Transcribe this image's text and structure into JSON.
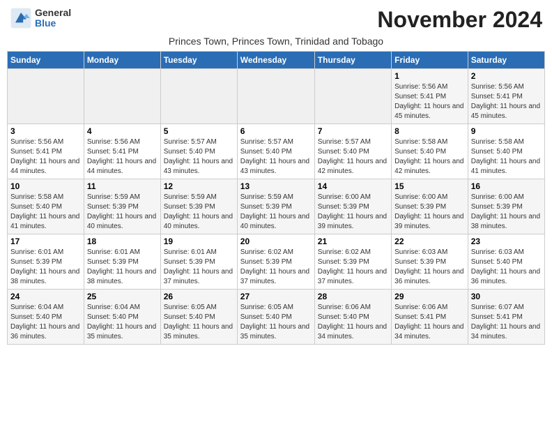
{
  "logo": {
    "general": "General",
    "blue": "Blue"
  },
  "title": "November 2024",
  "subtitle": "Princes Town, Princes Town, Trinidad and Tobago",
  "headers": [
    "Sunday",
    "Monday",
    "Tuesday",
    "Wednesday",
    "Thursday",
    "Friday",
    "Saturday"
  ],
  "rows": [
    [
      {
        "day": "",
        "info": ""
      },
      {
        "day": "",
        "info": ""
      },
      {
        "day": "",
        "info": ""
      },
      {
        "day": "",
        "info": ""
      },
      {
        "day": "",
        "info": ""
      },
      {
        "day": "1",
        "info": "Sunrise: 5:56 AM\nSunset: 5:41 PM\nDaylight: 11 hours and 45 minutes."
      },
      {
        "day": "2",
        "info": "Sunrise: 5:56 AM\nSunset: 5:41 PM\nDaylight: 11 hours and 45 minutes."
      }
    ],
    [
      {
        "day": "3",
        "info": "Sunrise: 5:56 AM\nSunset: 5:41 PM\nDaylight: 11 hours and 44 minutes."
      },
      {
        "day": "4",
        "info": "Sunrise: 5:56 AM\nSunset: 5:41 PM\nDaylight: 11 hours and 44 minutes."
      },
      {
        "day": "5",
        "info": "Sunrise: 5:57 AM\nSunset: 5:40 PM\nDaylight: 11 hours and 43 minutes."
      },
      {
        "day": "6",
        "info": "Sunrise: 5:57 AM\nSunset: 5:40 PM\nDaylight: 11 hours and 43 minutes."
      },
      {
        "day": "7",
        "info": "Sunrise: 5:57 AM\nSunset: 5:40 PM\nDaylight: 11 hours and 42 minutes."
      },
      {
        "day": "8",
        "info": "Sunrise: 5:58 AM\nSunset: 5:40 PM\nDaylight: 11 hours and 42 minutes."
      },
      {
        "day": "9",
        "info": "Sunrise: 5:58 AM\nSunset: 5:40 PM\nDaylight: 11 hours and 41 minutes."
      }
    ],
    [
      {
        "day": "10",
        "info": "Sunrise: 5:58 AM\nSunset: 5:40 PM\nDaylight: 11 hours and 41 minutes."
      },
      {
        "day": "11",
        "info": "Sunrise: 5:59 AM\nSunset: 5:39 PM\nDaylight: 11 hours and 40 minutes."
      },
      {
        "day": "12",
        "info": "Sunrise: 5:59 AM\nSunset: 5:39 PM\nDaylight: 11 hours and 40 minutes."
      },
      {
        "day": "13",
        "info": "Sunrise: 5:59 AM\nSunset: 5:39 PM\nDaylight: 11 hours and 40 minutes."
      },
      {
        "day": "14",
        "info": "Sunrise: 6:00 AM\nSunset: 5:39 PM\nDaylight: 11 hours and 39 minutes."
      },
      {
        "day": "15",
        "info": "Sunrise: 6:00 AM\nSunset: 5:39 PM\nDaylight: 11 hours and 39 minutes."
      },
      {
        "day": "16",
        "info": "Sunrise: 6:00 AM\nSunset: 5:39 PM\nDaylight: 11 hours and 38 minutes."
      }
    ],
    [
      {
        "day": "17",
        "info": "Sunrise: 6:01 AM\nSunset: 5:39 PM\nDaylight: 11 hours and 38 minutes."
      },
      {
        "day": "18",
        "info": "Sunrise: 6:01 AM\nSunset: 5:39 PM\nDaylight: 11 hours and 38 minutes."
      },
      {
        "day": "19",
        "info": "Sunrise: 6:01 AM\nSunset: 5:39 PM\nDaylight: 11 hours and 37 minutes."
      },
      {
        "day": "20",
        "info": "Sunrise: 6:02 AM\nSunset: 5:39 PM\nDaylight: 11 hours and 37 minutes."
      },
      {
        "day": "21",
        "info": "Sunrise: 6:02 AM\nSunset: 5:39 PM\nDaylight: 11 hours and 37 minutes."
      },
      {
        "day": "22",
        "info": "Sunrise: 6:03 AM\nSunset: 5:39 PM\nDaylight: 11 hours and 36 minutes."
      },
      {
        "day": "23",
        "info": "Sunrise: 6:03 AM\nSunset: 5:40 PM\nDaylight: 11 hours and 36 minutes."
      }
    ],
    [
      {
        "day": "24",
        "info": "Sunrise: 6:04 AM\nSunset: 5:40 PM\nDaylight: 11 hours and 36 minutes."
      },
      {
        "day": "25",
        "info": "Sunrise: 6:04 AM\nSunset: 5:40 PM\nDaylight: 11 hours and 35 minutes."
      },
      {
        "day": "26",
        "info": "Sunrise: 6:05 AM\nSunset: 5:40 PM\nDaylight: 11 hours and 35 minutes."
      },
      {
        "day": "27",
        "info": "Sunrise: 6:05 AM\nSunset: 5:40 PM\nDaylight: 11 hours and 35 minutes."
      },
      {
        "day": "28",
        "info": "Sunrise: 6:06 AM\nSunset: 5:40 PM\nDaylight: 11 hours and 34 minutes."
      },
      {
        "day": "29",
        "info": "Sunrise: 6:06 AM\nSunset: 5:41 PM\nDaylight: 11 hours and 34 minutes."
      },
      {
        "day": "30",
        "info": "Sunrise: 6:07 AM\nSunset: 5:41 PM\nDaylight: 11 hours and 34 minutes."
      }
    ]
  ]
}
